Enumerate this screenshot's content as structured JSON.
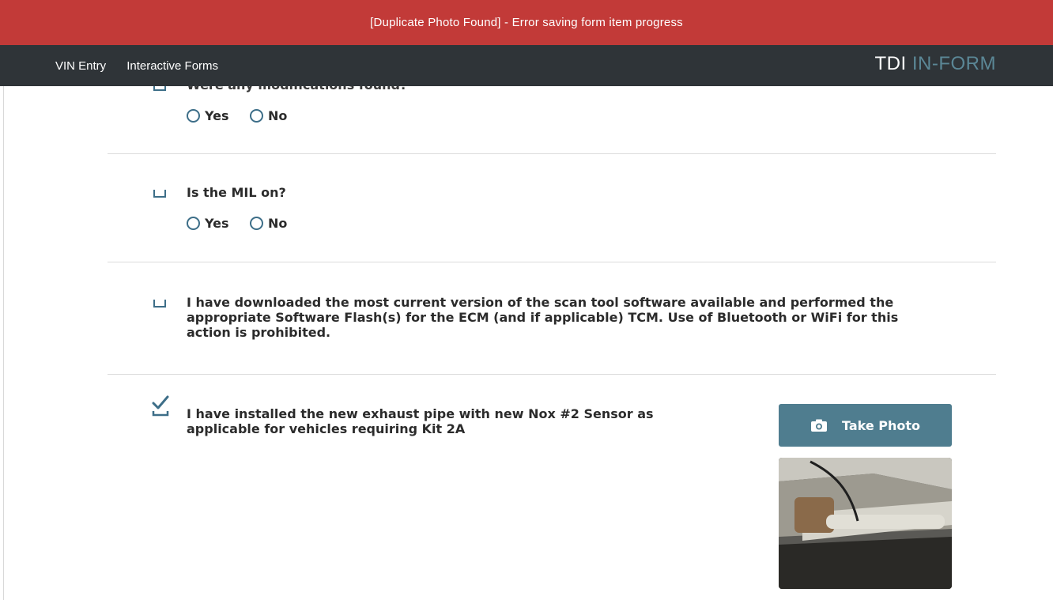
{
  "error_bar": {
    "message": "[Duplicate Photo Found] - Error saving form item progress",
    "color": "#c23a38"
  },
  "nav": {
    "items": [
      "VIN Entry",
      "Interactive Forms"
    ],
    "brand_primary": "TDI",
    "brand_secondary": "IN-FORM",
    "background": "#2f3438"
  },
  "form": {
    "q0": {
      "text": "Were any modifications found?",
      "yes": "Yes",
      "no": "No"
    },
    "q1": {
      "text": "Is the MIL on?",
      "yes": "Yes",
      "no": "No"
    },
    "q2": {
      "text_lines": [
        "I have downloaded the most current version of the scan tool software available and performed the",
        "appropriate Software Flash(s) for the ECM (and if applicable) TCM. Use of Bluetooth or WiFi for this",
        "action is prohibited."
      ]
    },
    "q3": {
      "text_lines": [
        "I have installed the new exhaust pipe with new Nox #2 Sensor as",
        "applicable for vehicles requiring Kit 2A"
      ],
      "checked": true
    },
    "photo_button": "Take Photo",
    "accent": "#3d6e88"
  }
}
